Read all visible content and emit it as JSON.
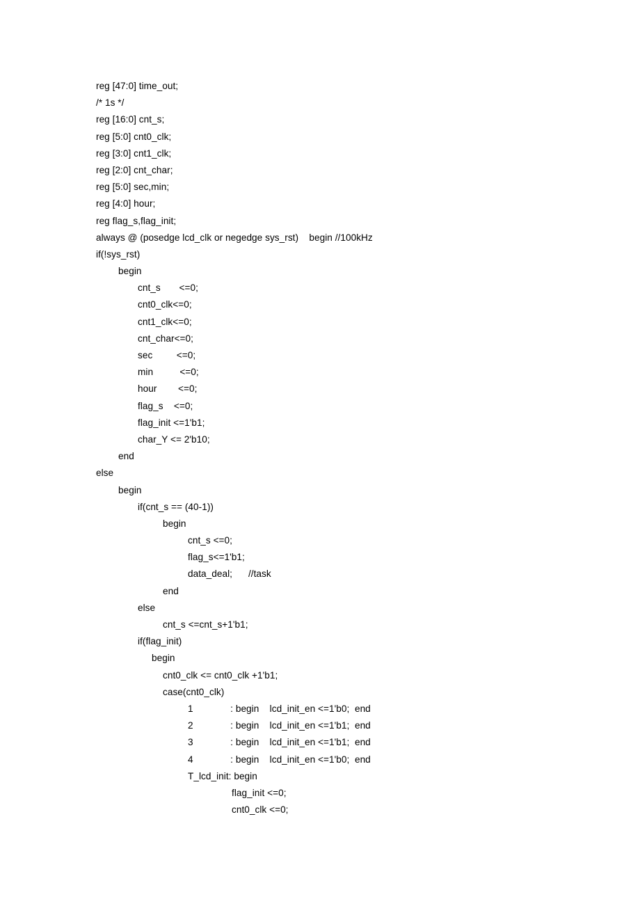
{
  "document": {
    "language": "Verilog",
    "background_color": "#ffffff",
    "text_color": "#000000",
    "lines": [
      {
        "indent": "i0",
        "text": "reg [47:0] time_out;"
      },
      {
        "indent": "i0",
        "text": "/* 1s */"
      },
      {
        "indent": "i0",
        "text": "reg [16:0] cnt_s;"
      },
      {
        "indent": "i0",
        "text": "reg [5:0] cnt0_clk;"
      },
      {
        "indent": "i0",
        "text": "reg [3:0] cnt1_clk;"
      },
      {
        "indent": "i0",
        "text": "reg [2:0] cnt_char;"
      },
      {
        "indent": "i0",
        "text": "reg [5:0] sec,min;"
      },
      {
        "indent": "i0",
        "text": "reg [4:0] hour;"
      },
      {
        "indent": "i0",
        "text": "reg flag_s,flag_init;"
      },
      {
        "indent": "i0",
        "text": "always @ (posedge lcd_clk or negedge sys_rst)    begin //100kHz"
      },
      {
        "indent": "i0",
        "text": "if(!sys_rst)"
      },
      {
        "indent": "i1",
        "text": "begin"
      },
      {
        "indent": "i2",
        "text": "cnt_s       <=0;"
      },
      {
        "indent": "i2",
        "text": "cnt0_clk<=0;"
      },
      {
        "indent": "i2",
        "text": "cnt1_clk<=0;"
      },
      {
        "indent": "i2",
        "text": "cnt_char<=0;"
      },
      {
        "indent": "i2",
        "text": "sec         <=0;"
      },
      {
        "indent": "i2",
        "text": "min          <=0;"
      },
      {
        "indent": "i2",
        "text": "hour        <=0;"
      },
      {
        "indent": "i2",
        "text": "flag_s    <=0;"
      },
      {
        "indent": "i2",
        "text": "flag_init <=1'b1;"
      },
      {
        "indent": "i2",
        "text": "char_Y <= 2'b10;"
      },
      {
        "indent": "i1",
        "text": "end"
      },
      {
        "indent": "i0",
        "text": "else"
      },
      {
        "indent": "i1",
        "text": "begin"
      },
      {
        "indent": "i2",
        "text": "if(cnt_s == (40-1))"
      },
      {
        "indent": "i3",
        "text": "begin"
      },
      {
        "indent": "i4",
        "text": "cnt_s <=0;"
      },
      {
        "indent": "i4",
        "text": "flag_s<=1'b1;"
      },
      {
        "indent": "i4",
        "text": "data_deal;      //task"
      },
      {
        "indent": "i3",
        "text": "end"
      },
      {
        "indent": "i2",
        "text": "else"
      },
      {
        "indent": "i3",
        "text": "cnt_s <=cnt_s+1'b1;"
      },
      {
        "indent": "i2",
        "text": "if(flag_init)"
      },
      {
        "indent": "i2b",
        "text": "begin"
      },
      {
        "indent": "i3",
        "text": "cnt0_clk <= cnt0_clk +1'b1;"
      },
      {
        "indent": "i3",
        "text": "case(cnt0_clk)"
      },
      {
        "indent": "i4",
        "text": "1              : begin    lcd_init_en <=1'b0;  end"
      },
      {
        "indent": "i4",
        "text": "2              : begin    lcd_init_en <=1'b1;  end"
      },
      {
        "indent": "i4",
        "text": "3              : begin    lcd_init_en <=1'b1;  end"
      },
      {
        "indent": "i4",
        "text": "4              : begin    lcd_init_en <=1'b0;  end"
      },
      {
        "indent": "i4",
        "text": "T_lcd_init: begin"
      },
      {
        "indent": "i5",
        "text": "flag_init <=0;"
      },
      {
        "indent": "i5",
        "text": "cnt0_clk <=0;"
      }
    ]
  }
}
